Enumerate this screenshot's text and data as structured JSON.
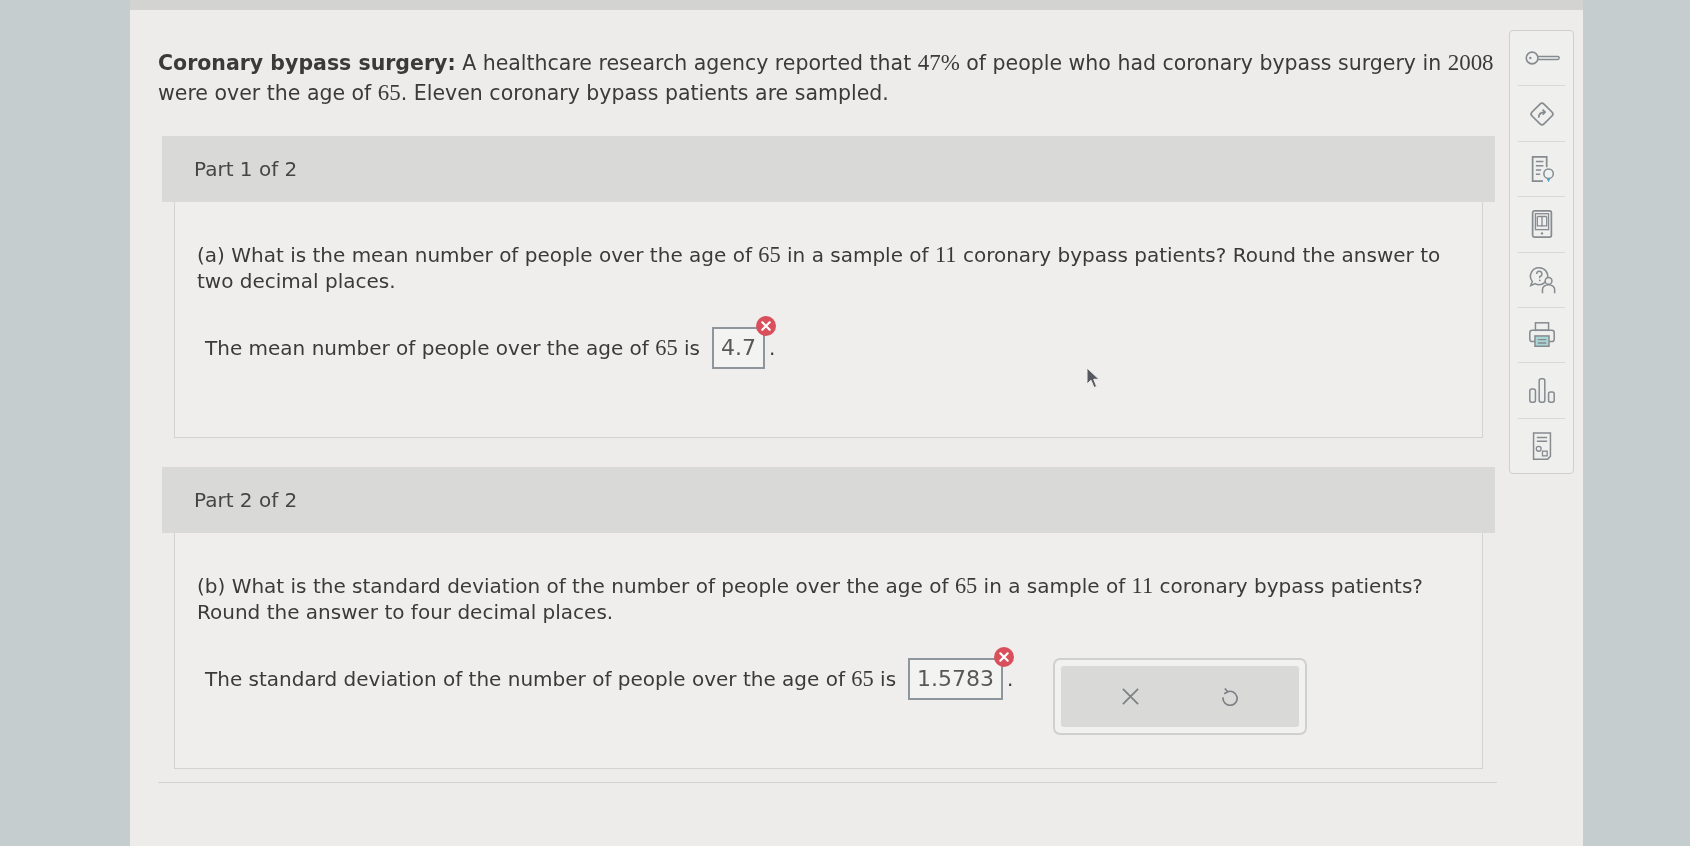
{
  "intro": {
    "segments": [
      {
        "kind": "bold",
        "text": "Coronary bypass surgery:"
      },
      {
        "kind": "text",
        "text": " A healthcare research agency reported that "
      },
      {
        "kind": "math",
        "text": "47%"
      },
      {
        "kind": "text",
        "text": " of people who had coronary bypass surgery in "
      },
      {
        "kind": "math",
        "text": "2008"
      },
      {
        "kind": "text",
        "text": " were over the age of "
      },
      {
        "kind": "math",
        "text": "65"
      },
      {
        "kind": "text",
        "text": ". Eleven coronary bypass patients are sampled."
      }
    ]
  },
  "parts": [
    {
      "title": "Part 1 of 2",
      "question": [
        {
          "kind": "text",
          "text": "(a) What is the mean number of people over the age of "
        },
        {
          "kind": "math",
          "text": "65"
        },
        {
          "kind": "text",
          "text": " in a sample of "
        },
        {
          "kind": "math",
          "text": "11"
        },
        {
          "kind": "text",
          "text": " coronary bypass patients? Round the answer to two decimal places."
        }
      ],
      "prompt": [
        {
          "kind": "text",
          "text": "The mean number of people over the age of "
        },
        {
          "kind": "math",
          "text": "65"
        },
        {
          "kind": "text",
          "text": " is"
        }
      ],
      "answer": {
        "value": "4.7",
        "incorrect": true
      },
      "after": "."
    },
    {
      "title": "Part 2 of 2",
      "question": [
        {
          "kind": "text",
          "text": "(b) What is the standard deviation of the number of people over the age of "
        },
        {
          "kind": "math",
          "text": "65"
        },
        {
          "kind": "text",
          "text": " in a sample of "
        },
        {
          "kind": "math",
          "text": "11"
        },
        {
          "kind": "text",
          "text": " coronary bypass patients? Round the answer to four decimal places."
        }
      ],
      "prompt": [
        {
          "kind": "text",
          "text": "The standard deviation of the number of people over the age of "
        },
        {
          "kind": "math",
          "text": "65"
        },
        {
          "kind": "text",
          "text": " is"
        }
      ],
      "answer": {
        "value": "1.5783",
        "incorrect": true
      },
      "after": ".",
      "tools": [
        {
          "kind": "clear"
        },
        {
          "kind": "undo"
        }
      ]
    }
  ]
}
